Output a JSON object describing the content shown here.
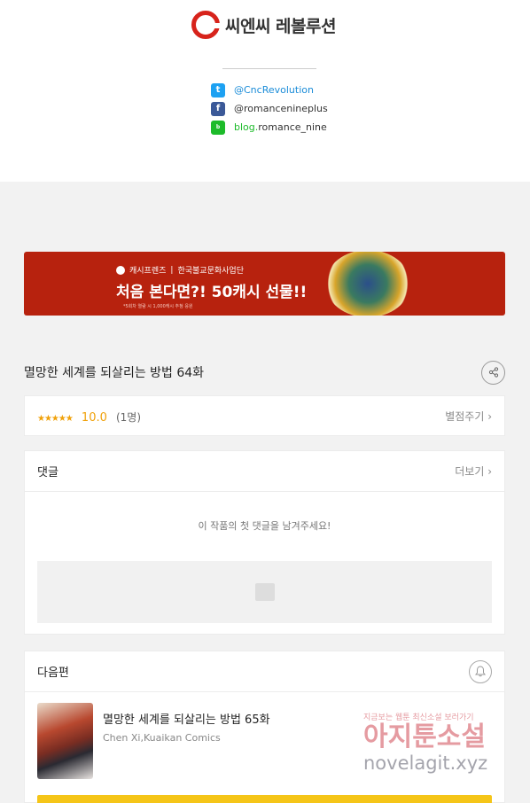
{
  "brand": {
    "name": "씨엔씨 레볼루션",
    "accent": "#d7231b"
  },
  "social": [
    {
      "icon": "twitter-icon",
      "label": "@CncRevolution"
    },
    {
      "icon": "facebook-icon",
      "label": "@romancenineplus"
    },
    {
      "icon": "blog-icon",
      "prefix": "blog.",
      "label": "romance_nine"
    }
  ],
  "banner": {
    "brand": "캐시프렌즈",
    "sponsor": "한국불교문화사업단",
    "title": "처음 본다면?! 50캐시 선물!!",
    "note": "*5회차 열람 시 1,000캐시 추첨 응원"
  },
  "episode": {
    "title": "멸망한 세계를 되살리는 방법 64화"
  },
  "rating": {
    "stars": "★★★★★",
    "score": "10.0",
    "count": "(1명)",
    "action": "별점주기 ›"
  },
  "comments": {
    "header": "댓글",
    "more": "더보기 ›",
    "empty": "이 작품의 첫 댓글을 남겨주세요!"
  },
  "next": {
    "header": "다음편",
    "title": "멸망한 세계를 되살리는 방법 65화",
    "author": "Chen Xi,Kuaikan Comics"
  },
  "watermark": {
    "line1": "지금보는 웹툰 최신소설 보러가기",
    "line2": "아지툰소설",
    "line3": "novelagit.xyz"
  }
}
